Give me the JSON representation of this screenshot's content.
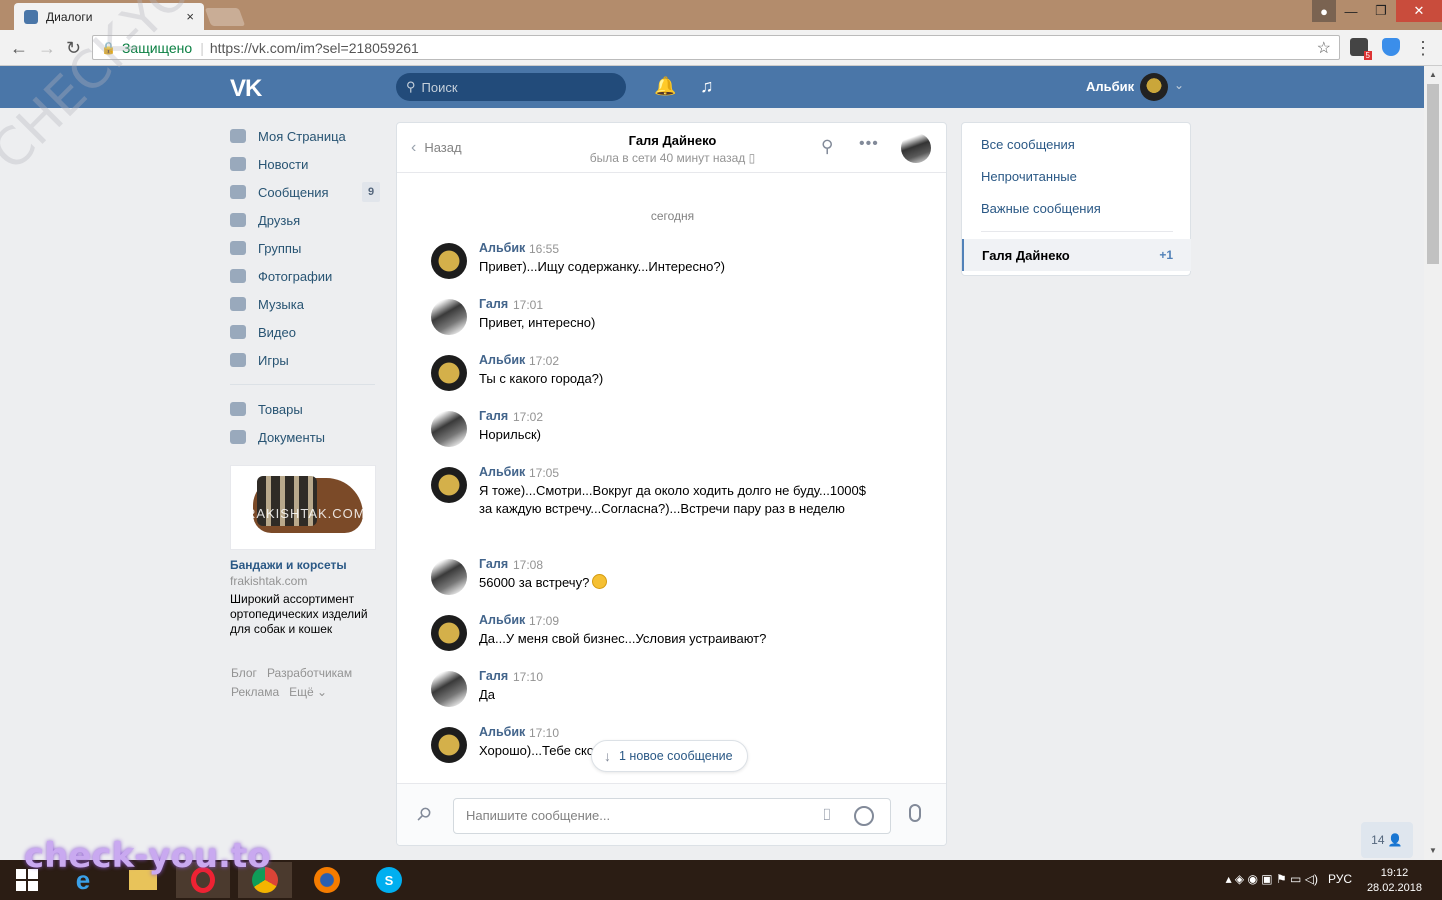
{
  "browser": {
    "tab_title": "Диалоги",
    "tab_close": "×",
    "secure_label": "Защищено",
    "url": "https://vk.com/im?sel=218059261",
    "ext_badge": "5"
  },
  "vk_header": {
    "logo": "VK",
    "search_placeholder": "Поиск",
    "user_name": "Альбик"
  },
  "left_nav": {
    "items": [
      {
        "label": "Моя Страница"
      },
      {
        "label": "Новости"
      },
      {
        "label": "Сообщения",
        "badge": "9"
      },
      {
        "label": "Друзья"
      },
      {
        "label": "Группы"
      },
      {
        "label": "Фотографии"
      },
      {
        "label": "Музыка"
      },
      {
        "label": "Видео"
      },
      {
        "label": "Игры"
      },
      {
        "label": "Товары"
      },
      {
        "label": "Документы"
      }
    ]
  },
  "ad": {
    "image_text": "FRAKISHTAK.COM",
    "title": "Бандажи и корсеты",
    "domain": "frakishtak.com",
    "text": "Широкий ассортимент ортопедических изделий для собак и кошек"
  },
  "footer": {
    "blog": "Блог",
    "developers": "Разработчикам",
    "ads": "Реклама",
    "more": "Ещё ⌄"
  },
  "chat": {
    "back_label": "Назад",
    "contact_name": "Галя Дайнеко",
    "contact_status": "была в сети 40 минут назад",
    "day_label": "сегодня",
    "messages": [
      {
        "author": "Альбик",
        "time": "16:55",
        "text": "Привет)...Ищу содержанку...Интересно?)"
      },
      {
        "author": "Галя",
        "time": "17:01",
        "text": "Привет, интересно)"
      },
      {
        "author": "Альбик",
        "time": "17:02",
        "text": "Ты с какого города?)"
      },
      {
        "author": "Галя",
        "time": "17:02",
        "text": "Норильск)"
      },
      {
        "author": "Альбик",
        "time": "17:05",
        "text": "Я тоже)...Смотри...Вокруг да около ходить долго не буду...1000$ за каждую встречу...Согласна?)...Встречи пару раз в неделю"
      },
      {
        "author": "Галя",
        "time": "17:08",
        "text": "56000 за встречу?"
      },
      {
        "author": "Альбик",
        "time": "17:09",
        "text": "Да...У меня свой бизнес...Условия устраивают?"
      },
      {
        "author": "Галя",
        "time": "17:10",
        "text": "Да"
      },
      {
        "author": "Альбик",
        "time": "17:10",
        "text": "Хорошо)...Тебе ско"
      }
    ],
    "new_message_pill": "1 новое сообщение",
    "composer_placeholder": "Напишите сообщение..."
  },
  "filters": {
    "all": "Все сообщения",
    "unread": "Непрочитанные",
    "important": "Важные сообщения",
    "selected_dialog": "Галя Дайнеко",
    "selected_count": "+1"
  },
  "online_count": "14",
  "taskbar": {
    "language": "РУС",
    "time": "19:12",
    "date": "28.02.2018"
  },
  "watermarks": {
    "bottom": "check-you.to",
    "diagonal": "CHECK-YOU.ME"
  }
}
